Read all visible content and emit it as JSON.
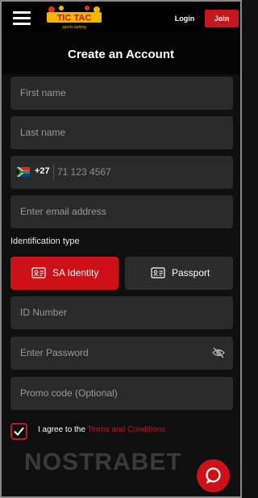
{
  "header": {
    "logo_text": "TIC TAC",
    "logo_sub": "sports betting",
    "login_label": "Login",
    "join_label": "Join"
  },
  "form": {
    "title": "Create an Account",
    "first_name_placeholder": "First name",
    "last_name_placeholder": "Last name",
    "phone_code": "+27",
    "phone_placeholder": "71 123 4567",
    "email_placeholder": "Enter email address",
    "id_type_label": "Identification type",
    "id_options": [
      {
        "label": "SA Identity",
        "selected": true
      },
      {
        "label": "Passport",
        "selected": false
      }
    ],
    "id_number_placeholder": "ID Number",
    "password_placeholder": "Enter Password",
    "promo_placeholder": "Promo code (Optional)",
    "agree_text": "I agree to the",
    "terms_link": "Terms and Conditions",
    "agree_checked": true
  },
  "watermark": "NOSTRABET",
  "colors": {
    "accent": "#c8161d",
    "field_bg": "#2a2a2a",
    "background": "#0f0f0f"
  },
  "icons": {
    "menu": "hamburger-icon",
    "flag": "south-africa-flag-icon",
    "id_card": "id-card-icon",
    "passport": "passport-card-icon",
    "password_toggle": "eye-slash-icon",
    "checkbox": "checkmark-icon",
    "chat": "chat-bubble-icon"
  }
}
